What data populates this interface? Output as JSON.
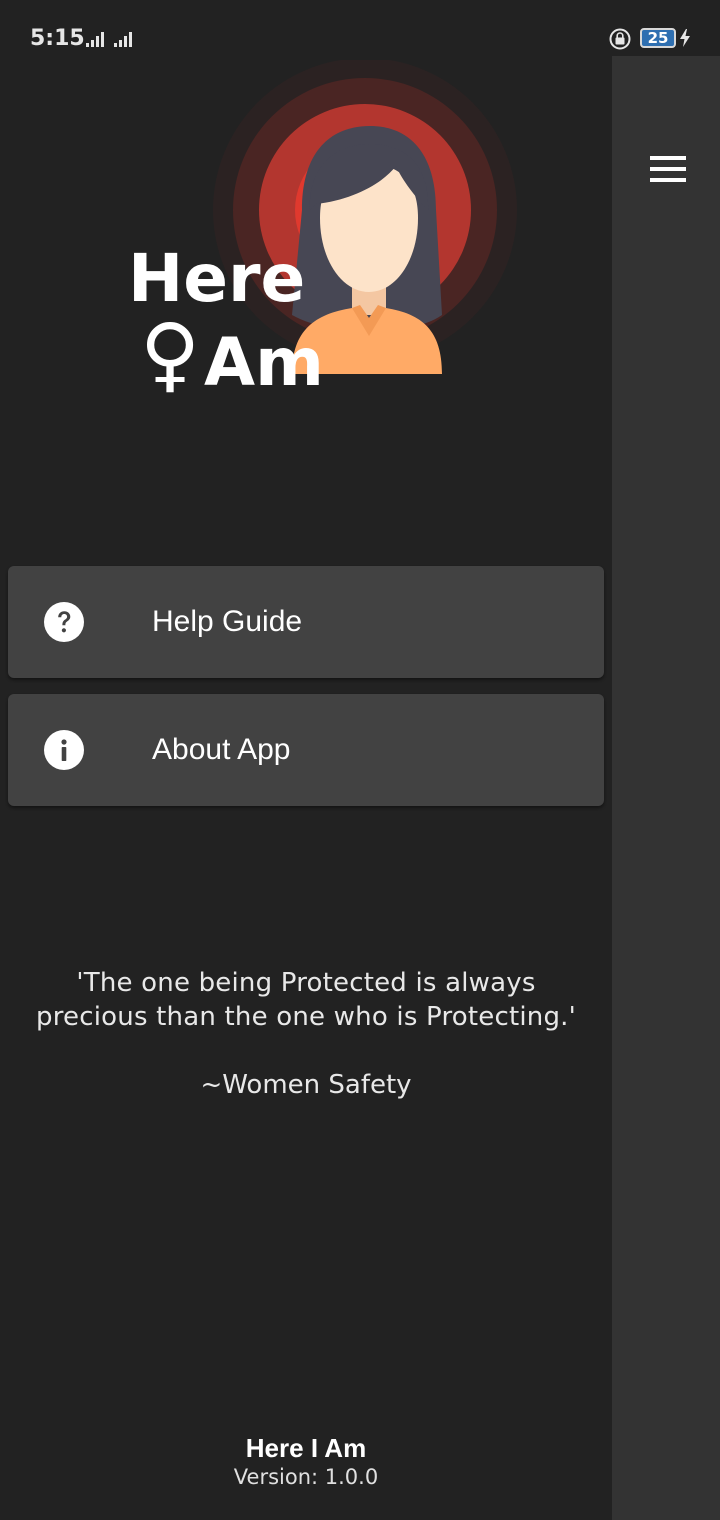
{
  "status_bar": {
    "time": "5:15",
    "battery_level": "25",
    "icons": [
      "signal-icon",
      "signal-icon",
      "screen-lock-icon",
      "battery-icon",
      "charging-icon"
    ]
  },
  "header": {
    "menu_icon": "hamburger-menu-icon"
  },
  "logo": {
    "line1": "Here",
    "line2_symbol": "♀",
    "line2_word": "Am",
    "colors": {
      "ring_outer": "#3a2220",
      "ring_mid": "#5b2a27",
      "ring_inner": "#b63a32",
      "hair": "#4a4a55",
      "face": "#fde3c9",
      "shirt": "#ffaa66"
    }
  },
  "menu": {
    "items": [
      {
        "label": "Help Guide",
        "icon": "help-icon"
      },
      {
        "label": "About App",
        "icon": "info-icon"
      }
    ]
  },
  "quote": {
    "line1": "'The one being Protected is always",
    "line2": "precious than the one who is Protecting.'",
    "author": "~Women Safety"
  },
  "footer": {
    "app_name": "Here I Am",
    "version": "Version: 1.0.0"
  },
  "colors": {
    "background": "#222222",
    "card": "#424242",
    "scrim": "#333333",
    "text": "#ffffff"
  }
}
